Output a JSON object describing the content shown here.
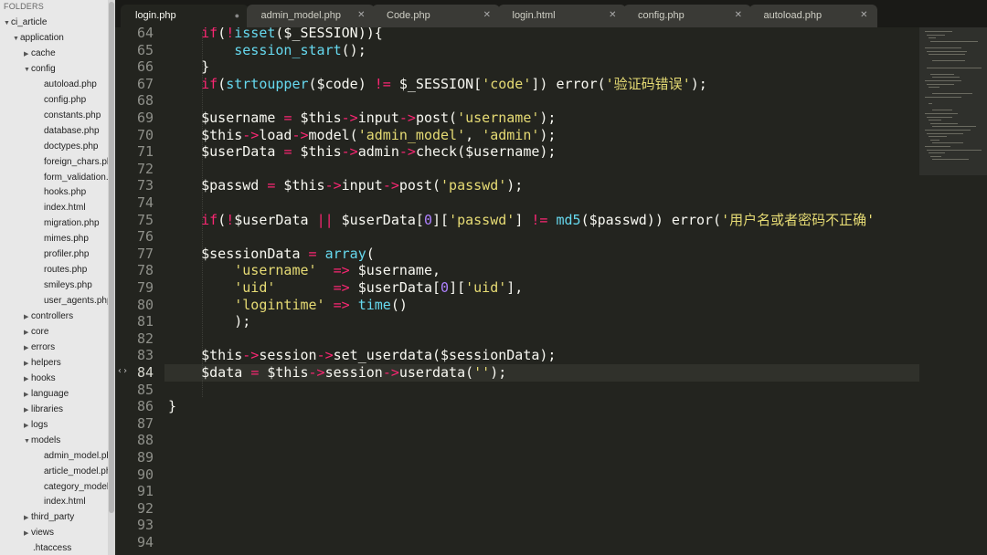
{
  "sidebar": {
    "header": "FOLDERS",
    "items": [
      {
        "label": "ci_article",
        "arrow": "▼"
      },
      {
        "label": "application",
        "arrow": "▼"
      },
      {
        "label": "cache",
        "arrow": "▶"
      },
      {
        "label": "config",
        "arrow": "▼"
      },
      {
        "label": "autoload.php",
        "arrow": ""
      },
      {
        "label": "config.php",
        "arrow": ""
      },
      {
        "label": "constants.php",
        "arrow": ""
      },
      {
        "label": "database.php",
        "arrow": ""
      },
      {
        "label": "doctypes.php",
        "arrow": ""
      },
      {
        "label": "foreign_chars.php",
        "arrow": ""
      },
      {
        "label": "form_validation.p",
        "arrow": ""
      },
      {
        "label": "hooks.php",
        "arrow": ""
      },
      {
        "label": "index.html",
        "arrow": ""
      },
      {
        "label": "migration.php",
        "arrow": ""
      },
      {
        "label": "mimes.php",
        "arrow": ""
      },
      {
        "label": "profiler.php",
        "arrow": ""
      },
      {
        "label": "routes.php",
        "arrow": ""
      },
      {
        "label": "smileys.php",
        "arrow": ""
      },
      {
        "label": "user_agents.php",
        "arrow": ""
      },
      {
        "label": "controllers",
        "arrow": "▶"
      },
      {
        "label": "core",
        "arrow": "▶"
      },
      {
        "label": "errors",
        "arrow": "▶"
      },
      {
        "label": "helpers",
        "arrow": "▶"
      },
      {
        "label": "hooks",
        "arrow": "▶"
      },
      {
        "label": "language",
        "arrow": "▶"
      },
      {
        "label": "libraries",
        "arrow": "▶"
      },
      {
        "label": "logs",
        "arrow": "▶"
      },
      {
        "label": "models",
        "arrow": "▼"
      },
      {
        "label": "admin_model.php",
        "arrow": ""
      },
      {
        "label": "article_model.php",
        "arrow": ""
      },
      {
        "label": "category_model.p",
        "arrow": ""
      },
      {
        "label": "index.html",
        "arrow": ""
      },
      {
        "label": "third_party",
        "arrow": "▶"
      },
      {
        "label": "views",
        "arrow": "▶"
      },
      {
        "label": ".htaccess",
        "arrow": ""
      }
    ]
  },
  "tabs": [
    {
      "label": "login.php",
      "close": "●",
      "active": true
    },
    {
      "label": "admin_model.php",
      "close": "✕",
      "active": false
    },
    {
      "label": "Code.php",
      "close": "✕",
      "active": false
    },
    {
      "label": "login.html",
      "close": "✕",
      "active": false
    },
    {
      "label": "config.php",
      "close": "✕",
      "active": false
    },
    {
      "label": "autoload.php",
      "close": "✕",
      "active": false
    }
  ],
  "editor": {
    "current_line": "84",
    "fold_marker": "‹›",
    "line_numbers": [
      "64",
      "65",
      "66",
      "67",
      "68",
      "69",
      "70",
      "71",
      "72",
      "73",
      "74",
      "75",
      "76",
      "77",
      "78",
      "79",
      "80",
      "81",
      "82",
      "83",
      "84",
      "85",
      "86",
      "87",
      "88",
      "89",
      "90",
      "91",
      "92",
      "93",
      "94"
    ],
    "lines": [
      [
        [
          "    ",
          "pl"
        ],
        [
          "if",
          "kw"
        ],
        [
          "(",
          "pl"
        ],
        [
          "!",
          "kw"
        ],
        [
          "isset",
          "fn"
        ],
        [
          "($_SESSION)){",
          "pl"
        ]
      ],
      [
        [
          "        ",
          "pl"
        ],
        [
          "session_start",
          "fn"
        ],
        [
          "();",
          "pl"
        ]
      ],
      [
        [
          "    }",
          "pl"
        ]
      ],
      [
        [
          "    ",
          "pl"
        ],
        [
          "if",
          "kw"
        ],
        [
          "(",
          "pl"
        ],
        [
          "strtoupper",
          "fn"
        ],
        [
          "($code) ",
          "pl"
        ],
        [
          "!=",
          "kw"
        ],
        [
          " $_SESSION[",
          "pl"
        ],
        [
          "'code'",
          "st"
        ],
        [
          "]) error(",
          "pl"
        ],
        [
          "'验证码错误'",
          "st"
        ],
        [
          ");",
          "pl"
        ]
      ],
      [],
      [
        [
          "    $username ",
          "pl"
        ],
        [
          "=",
          "kw"
        ],
        [
          " $this",
          "pl"
        ],
        [
          "->",
          "kw"
        ],
        [
          "input",
          "pl"
        ],
        [
          "->",
          "kw"
        ],
        [
          "post(",
          "pl"
        ],
        [
          "'username'",
          "st"
        ],
        [
          ");",
          "pl"
        ]
      ],
      [
        [
          "    $this",
          "pl"
        ],
        [
          "->",
          "kw"
        ],
        [
          "load",
          "pl"
        ],
        [
          "->",
          "kw"
        ],
        [
          "model(",
          "pl"
        ],
        [
          "'admin_model'",
          "st"
        ],
        [
          ", ",
          "pl"
        ],
        [
          "'admin'",
          "st"
        ],
        [
          ");",
          "pl"
        ]
      ],
      [
        [
          "    $userData ",
          "pl"
        ],
        [
          "=",
          "kw"
        ],
        [
          " $this",
          "pl"
        ],
        [
          "->",
          "kw"
        ],
        [
          "admin",
          "pl"
        ],
        [
          "->",
          "kw"
        ],
        [
          "check($username);",
          "pl"
        ]
      ],
      [],
      [
        [
          "    $passwd ",
          "pl"
        ],
        [
          "=",
          "kw"
        ],
        [
          " $this",
          "pl"
        ],
        [
          "->",
          "kw"
        ],
        [
          "input",
          "pl"
        ],
        [
          "->",
          "kw"
        ],
        [
          "post(",
          "pl"
        ],
        [
          "'passwd'",
          "st"
        ],
        [
          ");",
          "pl"
        ]
      ],
      [],
      [
        [
          "    ",
          "pl"
        ],
        [
          "if",
          "kw"
        ],
        [
          "(",
          "pl"
        ],
        [
          "!",
          "kw"
        ],
        [
          "$userData ",
          "pl"
        ],
        [
          "||",
          "kw"
        ],
        [
          " $userData[",
          "pl"
        ],
        [
          "0",
          "nm"
        ],
        [
          "][",
          "pl"
        ],
        [
          "'passwd'",
          "st"
        ],
        [
          "] ",
          "pl"
        ],
        [
          "!=",
          "kw"
        ],
        [
          " ",
          "pl"
        ],
        [
          "md5",
          "fn"
        ],
        [
          "($passwd)) error(",
          "pl"
        ],
        [
          "'用户名或者密码不正确'",
          "st"
        ]
      ],
      [],
      [
        [
          "    $sessionData ",
          "pl"
        ],
        [
          "=",
          "kw"
        ],
        [
          " ",
          "pl"
        ],
        [
          "array",
          "fn"
        ],
        [
          "(",
          "pl"
        ]
      ],
      [
        [
          "        ",
          "pl"
        ],
        [
          "'username'",
          "st"
        ],
        [
          "  ",
          "pl"
        ],
        [
          "=>",
          "kw"
        ],
        [
          " $username,",
          "pl"
        ]
      ],
      [
        [
          "        ",
          "pl"
        ],
        [
          "'uid'",
          "st"
        ],
        [
          "       ",
          "pl"
        ],
        [
          "=>",
          "kw"
        ],
        [
          " $userData[",
          "pl"
        ],
        [
          "0",
          "nm"
        ],
        [
          "][",
          "pl"
        ],
        [
          "'uid'",
          "st"
        ],
        [
          "],",
          "pl"
        ]
      ],
      [
        [
          "        ",
          "pl"
        ],
        [
          "'logintime'",
          "st"
        ],
        [
          " ",
          "pl"
        ],
        [
          "=>",
          "kw"
        ],
        [
          " ",
          "pl"
        ],
        [
          "time",
          "fn"
        ],
        [
          "()",
          "pl"
        ]
      ],
      [
        [
          "        );",
          "pl"
        ]
      ],
      [],
      [
        [
          "    $this",
          "pl"
        ],
        [
          "->",
          "kw"
        ],
        [
          "session",
          "pl"
        ],
        [
          "->",
          "kw"
        ],
        [
          "set_userdata($sessionData);",
          "pl"
        ]
      ],
      [
        [
          "    $data ",
          "pl"
        ],
        [
          "=",
          "kw"
        ],
        [
          " $this",
          "pl"
        ],
        [
          "->",
          "kw"
        ],
        [
          "session",
          "pl"
        ],
        [
          "->",
          "kw"
        ],
        [
          "userdata(",
          "pl"
        ],
        [
          "''",
          "st"
        ],
        [
          ");",
          "pl"
        ]
      ],
      [],
      [
        [
          "}",
          "pl"
        ]
      ],
      [],
      [],
      [],
      [],
      [],
      [],
      [],
      []
    ]
  }
}
